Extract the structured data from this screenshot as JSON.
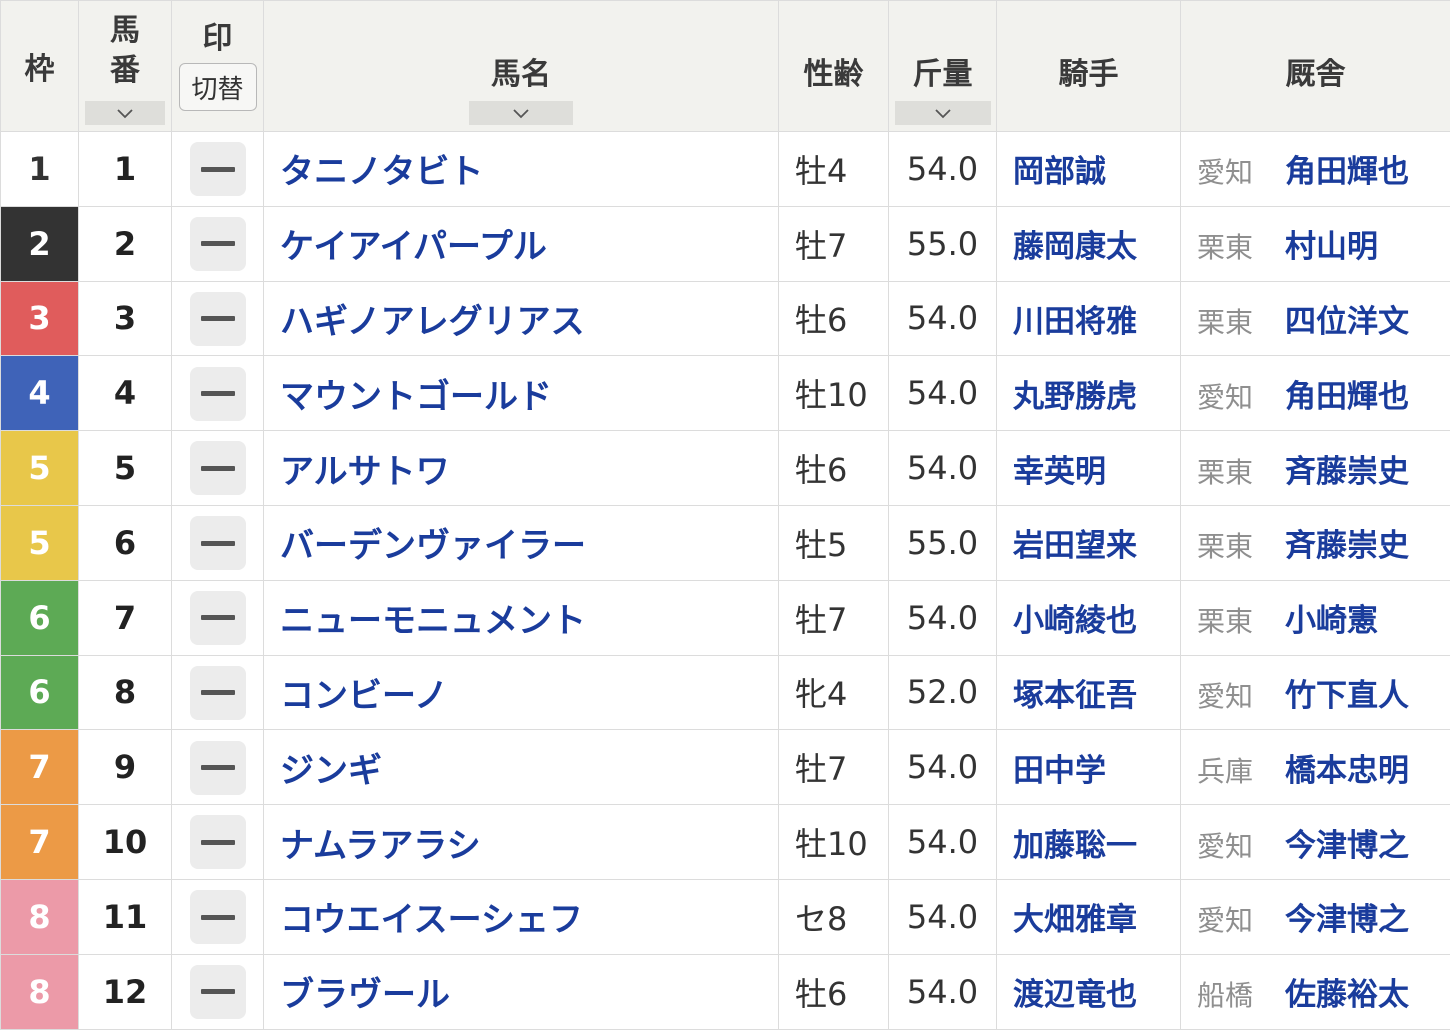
{
  "header": {
    "waku": "枠",
    "umaban_l1": "馬",
    "umaban_l2": "番",
    "mark": "印",
    "mark_toggle": "切替",
    "horse_name": "馬名",
    "sex_age": "性齢",
    "weight": "斤量",
    "jockey": "騎手",
    "stable": "厩舎"
  },
  "waku_colors": {
    "1": {
      "bg": "#ffffff",
      "fg": "#333333"
    },
    "2": {
      "bg": "#333333",
      "fg": "#ffffff"
    },
    "3": {
      "bg": "#e05c5c",
      "fg": "#ffffff"
    },
    "4": {
      "bg": "#3f63b8",
      "fg": "#ffffff"
    },
    "5": {
      "bg": "#e8c74a",
      "fg": "#ffffff"
    },
    "6": {
      "bg": "#5daa55",
      "fg": "#ffffff"
    },
    "7": {
      "bg": "#ec9a46",
      "fg": "#ffffff"
    },
    "8": {
      "bg": "#ec9aa8",
      "fg": "#ffffff"
    }
  },
  "mark_placeholder": "--",
  "rows": [
    {
      "waku": "1",
      "umaban": "1",
      "horse": "タニノタビト",
      "sex_age": "牡4",
      "weight": "54.0",
      "jockey": "岡部誠",
      "region": "愛知",
      "trainer": "角田輝也"
    },
    {
      "waku": "2",
      "umaban": "2",
      "horse": "ケイアイパープル",
      "sex_age": "牡7",
      "weight": "55.0",
      "jockey": "藤岡康太",
      "region": "栗東",
      "trainer": "村山明"
    },
    {
      "waku": "3",
      "umaban": "3",
      "horse": "ハギノアレグリアス",
      "sex_age": "牡6",
      "weight": "54.0",
      "jockey": "川田将雅",
      "region": "栗東",
      "trainer": "四位洋文"
    },
    {
      "waku": "4",
      "umaban": "4",
      "horse": "マウントゴールド",
      "sex_age": "牡10",
      "weight": "54.0",
      "jockey": "丸野勝虎",
      "region": "愛知",
      "trainer": "角田輝也"
    },
    {
      "waku": "5",
      "umaban": "5",
      "horse": "アルサトワ",
      "sex_age": "牡6",
      "weight": "54.0",
      "jockey": "幸英明",
      "region": "栗東",
      "trainer": "斉藤崇史"
    },
    {
      "waku": "5",
      "umaban": "6",
      "horse": "バーデンヴァイラー",
      "sex_age": "牡5",
      "weight": "55.0",
      "jockey": "岩田望来",
      "region": "栗東",
      "trainer": "斉藤崇史"
    },
    {
      "waku": "6",
      "umaban": "7",
      "horse": "ニューモニュメント",
      "sex_age": "牡7",
      "weight": "54.0",
      "jockey": "小崎綾也",
      "region": "栗東",
      "trainer": "小崎憲"
    },
    {
      "waku": "6",
      "umaban": "8",
      "horse": "コンビーノ",
      "sex_age": "牝4",
      "weight": "52.0",
      "jockey": "塚本征吾",
      "region": "愛知",
      "trainer": "竹下直人"
    },
    {
      "waku": "7",
      "umaban": "9",
      "horse": "ジンギ",
      "sex_age": "牡7",
      "weight": "54.0",
      "jockey": "田中学",
      "region": "兵庫",
      "trainer": "橋本忠明"
    },
    {
      "waku": "7",
      "umaban": "10",
      "horse": "ナムラアラシ",
      "sex_age": "牡10",
      "weight": "54.0",
      "jockey": "加藤聡一",
      "region": "愛知",
      "trainer": "今津博之"
    },
    {
      "waku": "8",
      "umaban": "11",
      "horse": "コウエイスーシェフ",
      "sex_age": "セ8",
      "weight": "54.0",
      "jockey": "大畑雅章",
      "region": "愛知",
      "trainer": "今津博之"
    },
    {
      "waku": "8",
      "umaban": "12",
      "horse": "ブラヴール",
      "sex_age": "牡6",
      "weight": "54.0",
      "jockey": "渡辺竜也",
      "region": "船橋",
      "trainer": "佐藤裕太"
    }
  ]
}
